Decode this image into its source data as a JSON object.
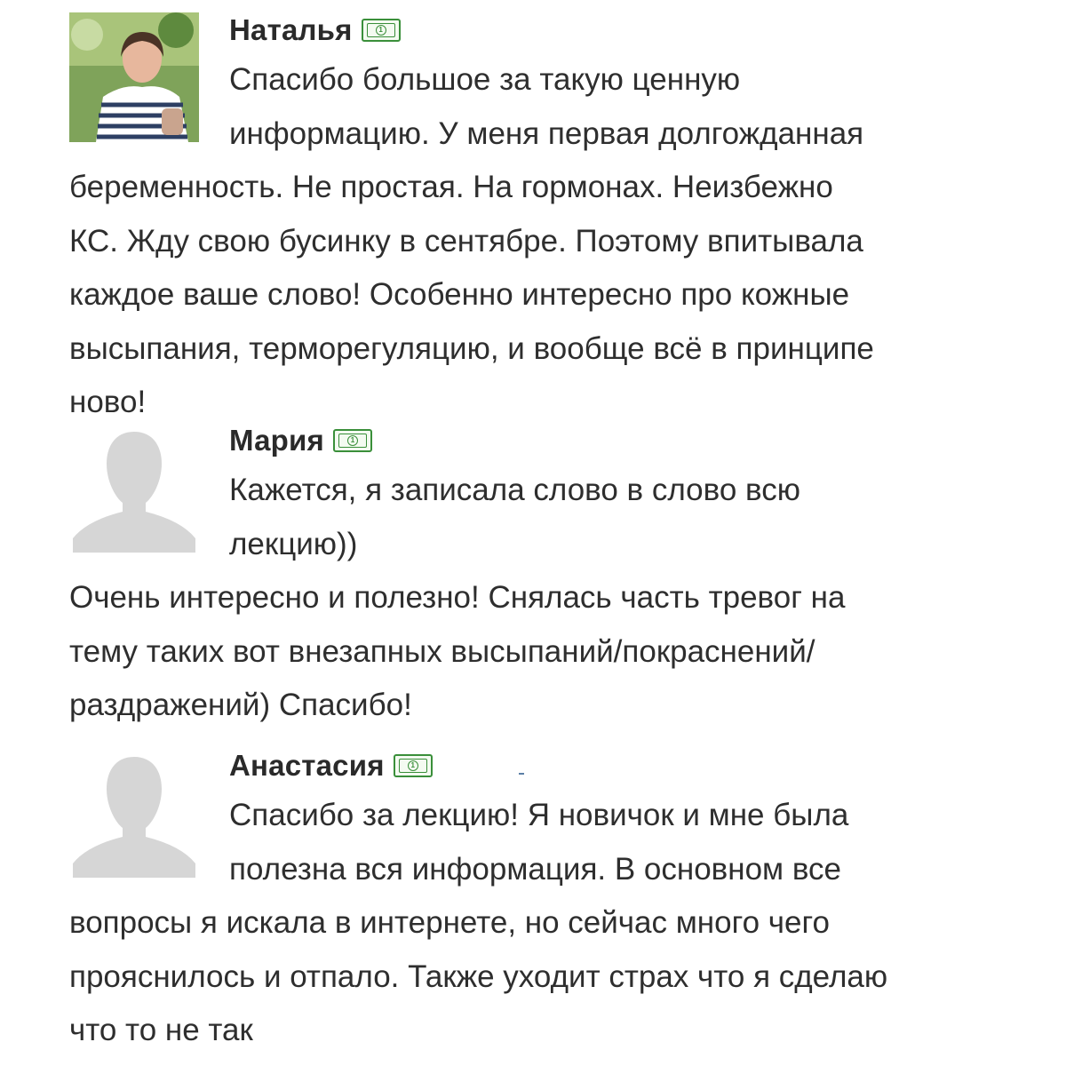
{
  "comments": [
    {
      "author": "Наталья",
      "avatar": "user-photo",
      "badge_icon": "money-bill-icon",
      "lines": [
        "Спасибо большое за такую ценную",
        "информацию. У меня первая долгожданная",
        "беременность. Не простая. На гормонах. Неизбежно",
        "КС. Жду свою бусинку в сентябре. Поэтому впитывала",
        "каждое ваше слово! Особенно интересно про кожные",
        "высыпания, терморегуляцию, и вообще всё в принципе",
        "ново!"
      ]
    },
    {
      "author": "Мария",
      "avatar": "default-user-silhouette",
      "badge_icon": "money-bill-icon",
      "lines": [
        "Кажется, я записала слово в слово всю",
        "лекцию))",
        "Очень интересно и полезно! Снялась часть тревог на",
        "тему таких вот внезапных высыпаний/покраснений/",
        "раздражений) Спасибо!"
      ]
    },
    {
      "author": "Анастасия",
      "avatar": "default-user-silhouette",
      "badge_icon": "money-bill-icon",
      "lines": [
        "Спасибо за лекцию! Я новичок и мне была",
        "полезна вся информация. В основном все",
        "вопросы я искала в интернете, но сейчас много чего",
        "прояснилось и отпало. Также уходит страх что я сделаю",
        "что то не так"
      ]
    }
  ],
  "colors": {
    "badge_green": "#3a8f3a",
    "text": "#2e2e2e",
    "silhouette": "#d6d6d6"
  }
}
